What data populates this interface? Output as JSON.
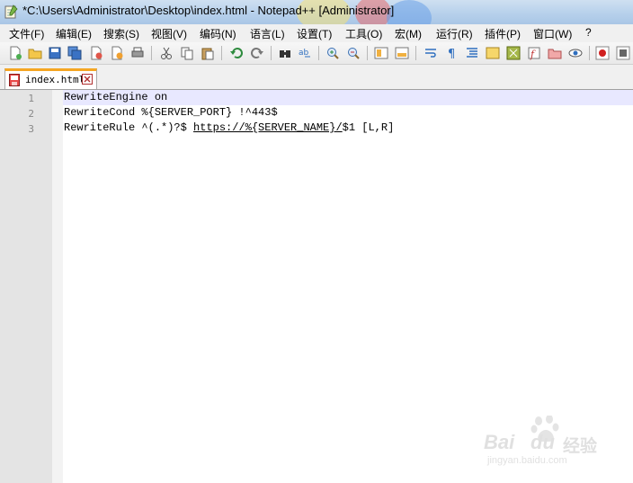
{
  "window": {
    "title": "*C:\\Users\\Administrator\\Desktop\\index.html - Notepad++ [Administrator]"
  },
  "menu": {
    "items": [
      "文件(F)",
      "编辑(E)",
      "搜索(S)",
      "视图(V)",
      "编码(N)",
      "语言(L)",
      "设置(T)",
      "工具(O)",
      "宏(M)",
      "运行(R)",
      "插件(P)",
      "窗口(W)",
      "?"
    ]
  },
  "toolbar": {
    "icons": [
      "new-file-icon",
      "open-file-icon",
      "save-icon",
      "save-all-icon",
      "close-icon",
      "close-all-icon",
      "print-icon",
      "cut-icon",
      "copy-icon",
      "paste-icon",
      "undo-icon",
      "redo-icon",
      "find-icon",
      "replace-icon",
      "zoom-in-icon",
      "zoom-out-icon",
      "sync-vertical-icon",
      "sync-horizontal-icon",
      "word-wrap-icon",
      "show-all-chars-icon",
      "indent-guide-icon",
      "udl-icon",
      "doc-map-icon",
      "function-list-icon",
      "folder-workspace-icon",
      "monitor-icon",
      "record-macro-icon",
      "stop-record-icon"
    ]
  },
  "tabs": [
    {
      "label": "index.html",
      "modified": true
    }
  ],
  "editor": {
    "lines": [
      {
        "num": "1",
        "text": "RewriteEngine on"
      },
      {
        "num": "2",
        "text": "RewriteCond %{SERVER_PORT} !^443$"
      },
      {
        "num": "3",
        "pre": "RewriteRule ^(.*)?$ ",
        "url": "https://%{SERVER_NAME}/",
        "post": "$1 [L,R]"
      }
    ]
  },
  "watermark": {
    "brand": "Bai",
    "brand_mark": "du",
    "brand_cn": "经验",
    "site": "jingyan.baidu.com"
  },
  "colors": {
    "tab_accent": "#f5a623",
    "current_line": "#e8e8ff",
    "gutter": "#e4e4e4"
  }
}
